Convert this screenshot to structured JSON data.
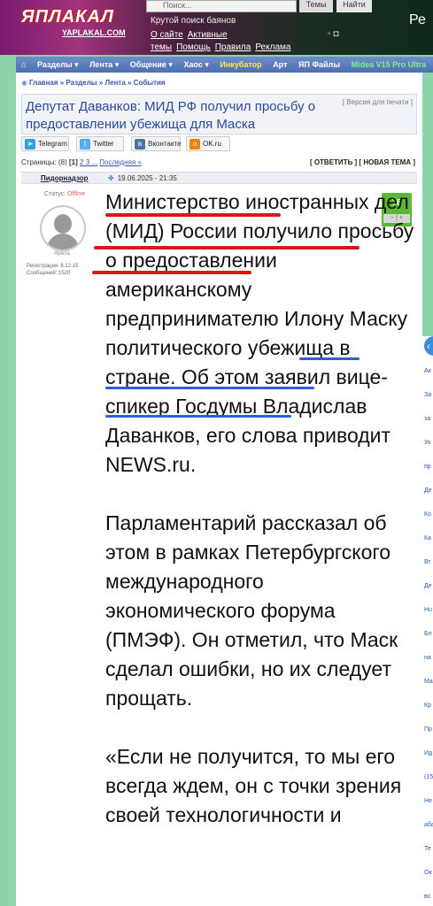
{
  "header": {
    "logo_text": "ЯПЛАКАЛ",
    "logo_sub": "YAPLAKAL.COM",
    "search_placeholder": "Поиск...",
    "themes_label": "Темы",
    "find_label": "Найти",
    "tagline": "Крутой поиск баянов",
    "links": [
      "О сайте",
      "Активные темы",
      "Помощь",
      "Правила",
      "Реклама"
    ],
    "side_text": "Ре"
  },
  "nav": {
    "items": [
      "Разделы ▾",
      "Лента ▾",
      "Общение ▾",
      "Хаос ▾",
      "Инкубатор",
      "Арт",
      "ЯП Файлы",
      "Midea V15 Pro Ultra"
    ]
  },
  "breadcrumb": "Главная » Разделы » Лента » События",
  "post": {
    "title": "Депутат Даванков: МИД РФ получил просьбу о предоставлении убежища для Маска",
    "print_link": "[ Версия для печати ]",
    "share": [
      "Telegram",
      "Twitter",
      "Вконтакте",
      "OK.ru"
    ],
    "pages_prefix": "Страницы: (8)",
    "pages_current": "[1]",
    "pages_links": "2 3 ...",
    "pages_last": "Последняя »",
    "actions": "[ ОТВЕТИТЬ ] [ НОВАЯ ТЕМА ]",
    "author": "Пидорнадзор",
    "date": "19.06.2025 - 21:35",
    "status_label": "Статус:",
    "status_value": "Offline",
    "avatar_caption": "Ярила",
    "reg": "Регистрация: 8.12.15",
    "messages": "Сообщений: 1520",
    "rating": "78",
    "rating_ctrl": "− | +",
    "paragraphs": [
      "Министерство иностранных дел (МИД) России получило просьбу о предоставлении американскому предпринимателю Илону Маску политического убежища в стране. Об этом заявил вице-спикер Госдумы Владислав Даванков, его слова приводит NEWS.ru.",
      "Парламентарий рассказал об этом в рамках Петербургского международного экономического форума (ПМЭФ). Он отметил, что Маск сделал ошибки, но их следует прощать.",
      "«Если не получится, то мы его всегда ждем, он с точки зрения своей технологичности и"
    ]
  },
  "right_sidebar": {
    "items": [
      "Ак",
      "За",
      "за",
      "Ук",
      "пр",
      "Де",
      "Ко",
      "Ка",
      "Вт",
      "Де",
      "Нu",
      "Бл",
      "на",
      "Ма",
      "Кр",
      "Пр",
      "Ид",
      "(15",
      "Не",
      "аба",
      "Те",
      "Ок",
      "вс"
    ]
  },
  "colors": {
    "accent_blue": "#2a4a9a",
    "red_underline": "#d91818",
    "blue_underline": "#2f5de0",
    "rating_green": "#5ab832"
  }
}
